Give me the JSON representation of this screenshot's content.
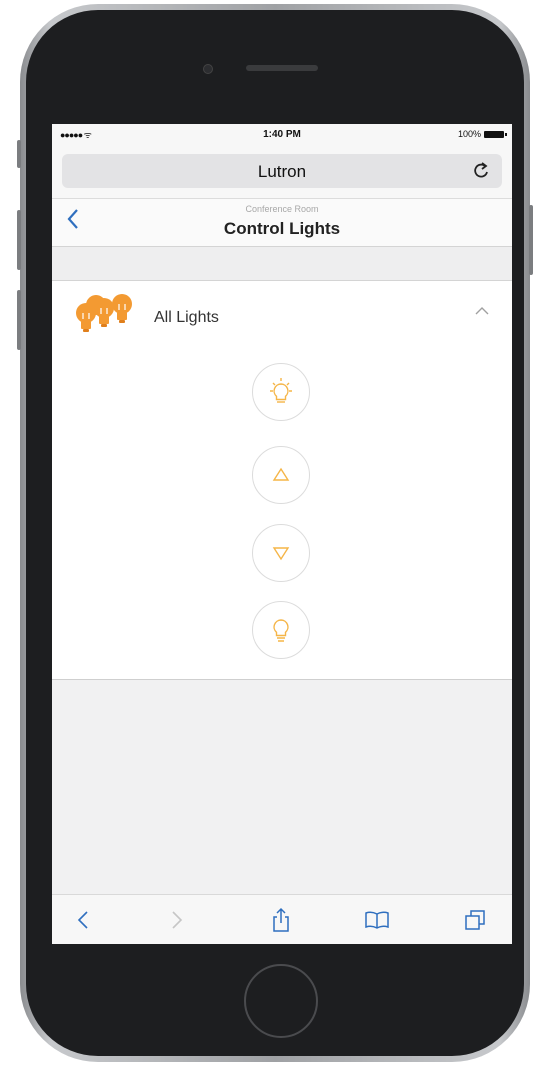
{
  "status_bar": {
    "signal": "●●●●● ᯤ",
    "time": "1:40 PM",
    "battery": "100%"
  },
  "browser": {
    "address": "Lutron"
  },
  "header": {
    "subtitle": "Conference Room",
    "title": "Control Lights"
  },
  "panel": {
    "label": "All Lights",
    "accent_color": "#f39a32"
  },
  "controls": [
    {
      "icon": "light-on-icon"
    },
    {
      "icon": "raise-icon"
    },
    {
      "icon": "lower-icon"
    },
    {
      "icon": "light-off-icon"
    }
  ],
  "toolbar": {
    "icons": [
      "back-icon",
      "forward-icon",
      "share-icon",
      "bookmarks-icon",
      "tabs-icon"
    ]
  }
}
